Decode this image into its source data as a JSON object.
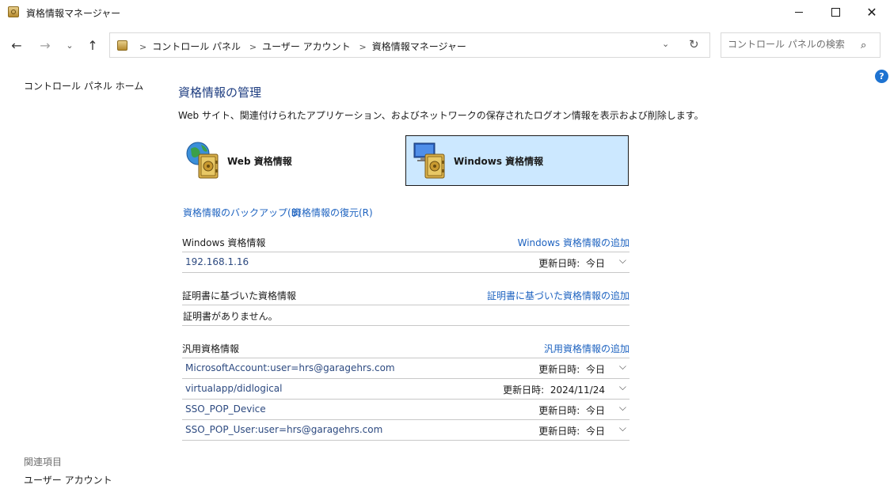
{
  "window": {
    "title": "資格情報マネージャー",
    "controls": {
      "minimize": "",
      "maximize": "",
      "close": "✕"
    }
  },
  "nav": {
    "back": "←",
    "forward": "→",
    "recent": "⌄",
    "up": "↑",
    "breadcrumbs": [
      "コントロール パネル",
      "ユーザー アカウント",
      "資格情報マネージャー"
    ],
    "separator": ">",
    "dropdown": "⌄",
    "refresh": "↻"
  },
  "search": {
    "placeholder": "コントロール パネルの検索",
    "icon": "⌕"
  },
  "help": {
    "label": "?"
  },
  "sidebar": {
    "home": "コントロール パネル ホーム",
    "related_title": "関連項目",
    "related_items": [
      "ユーザー アカウント"
    ]
  },
  "main": {
    "title": "資格情報の管理",
    "description": "Web サイト、関連付けられたアプリケーション、およびネットワークの保存されたログオン情報を表示および削除します。",
    "tiles": [
      {
        "label": "Web 資格情報",
        "selected": false,
        "icon": "globe-vault-icon"
      },
      {
        "label": "Windows 資格情報",
        "selected": true,
        "icon": "computer-vault-icon"
      }
    ],
    "links": {
      "backup": "資格情報のバックアップ(B)",
      "restore": "資格情報の復元(R)"
    },
    "sections": {
      "windows": {
        "title": "Windows 資格情報",
        "add": "Windows 資格情報の追加",
        "items": [
          {
            "name": "192.168.1.16",
            "date_label": "更新日時:",
            "date": "今日"
          }
        ]
      },
      "certificate": {
        "title": "証明書に基づいた資格情報",
        "add": "証明書に基づいた資格情報の追加",
        "empty": "証明書がありません。"
      },
      "generic": {
        "title": "汎用資格情報",
        "add": "汎用資格情報の追加",
        "items": [
          {
            "name": "MicrosoftAccount:user=hrs@garagehrs.com",
            "date_label": "更新日時:",
            "date": "今日"
          },
          {
            "name": "virtualapp/didlogical",
            "date_label": "更新日時:",
            "date": "2024/11/24"
          },
          {
            "name": "SSO_POP_Device",
            "date_label": "更新日時:",
            "date": "今日"
          },
          {
            "name": "SSO_POP_User:user=hrs@garagehrs.com",
            "date_label": "更新日時:",
            "date": "今日"
          }
        ]
      }
    },
    "expand_glyph": "⌵"
  },
  "colors": {
    "accent": "#1e63c0",
    "selected_tile": "#cce8ff",
    "title_blue": "#1e3d80"
  }
}
